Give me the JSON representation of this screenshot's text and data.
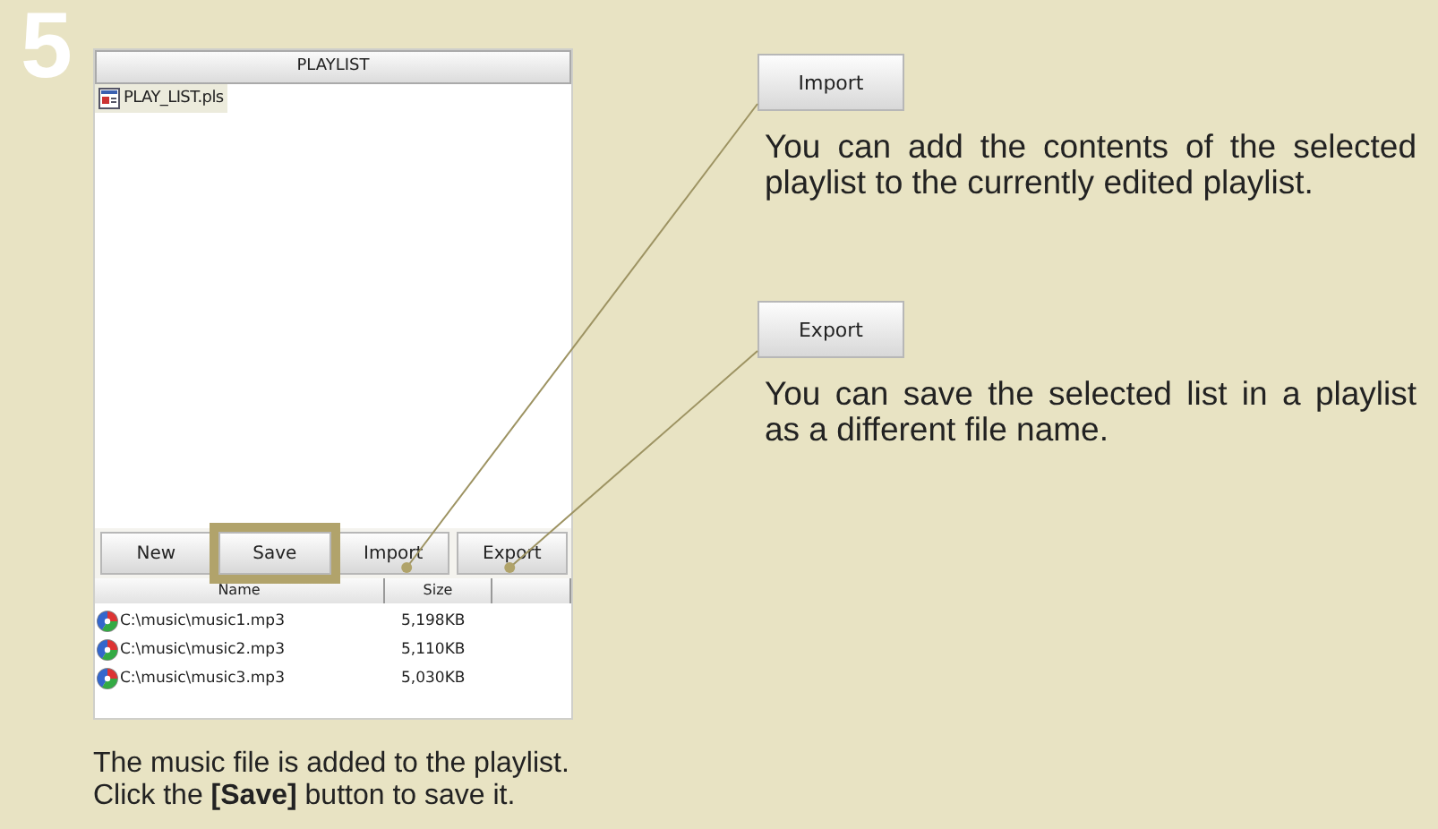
{
  "step": "5",
  "playlist": {
    "title": "PLAYLIST",
    "items": [
      {
        "name": "PLAY_LIST.pls",
        "selected": true
      }
    ]
  },
  "buttons": [
    {
      "label": "New",
      "highlighted": false
    },
    {
      "label": "Save",
      "highlighted": true
    },
    {
      "label": "Import",
      "highlighted": false
    },
    {
      "label": "Export",
      "highlighted": false
    }
  ],
  "file_table": {
    "columns": [
      "Name",
      "Size"
    ],
    "rows": [
      {
        "name": "C:\\music\\music1.mp3",
        "size": "5,198KB"
      },
      {
        "name": "C:\\music\\music2.mp3",
        "size": "5,110KB"
      },
      {
        "name": "C:\\music\\music3.mp3",
        "size": "5,030KB"
      }
    ]
  },
  "callouts": [
    {
      "button": "Import",
      "text": "You can add the contents of the selected playlist to the currently edited playlist."
    },
    {
      "button": "Export",
      "text": "You can save the selected list in a playlist as a different file name."
    }
  ],
  "caption": [
    "The music file is added to the playlist.",
    "Click the **[Save]** button to save it."
  ]
}
